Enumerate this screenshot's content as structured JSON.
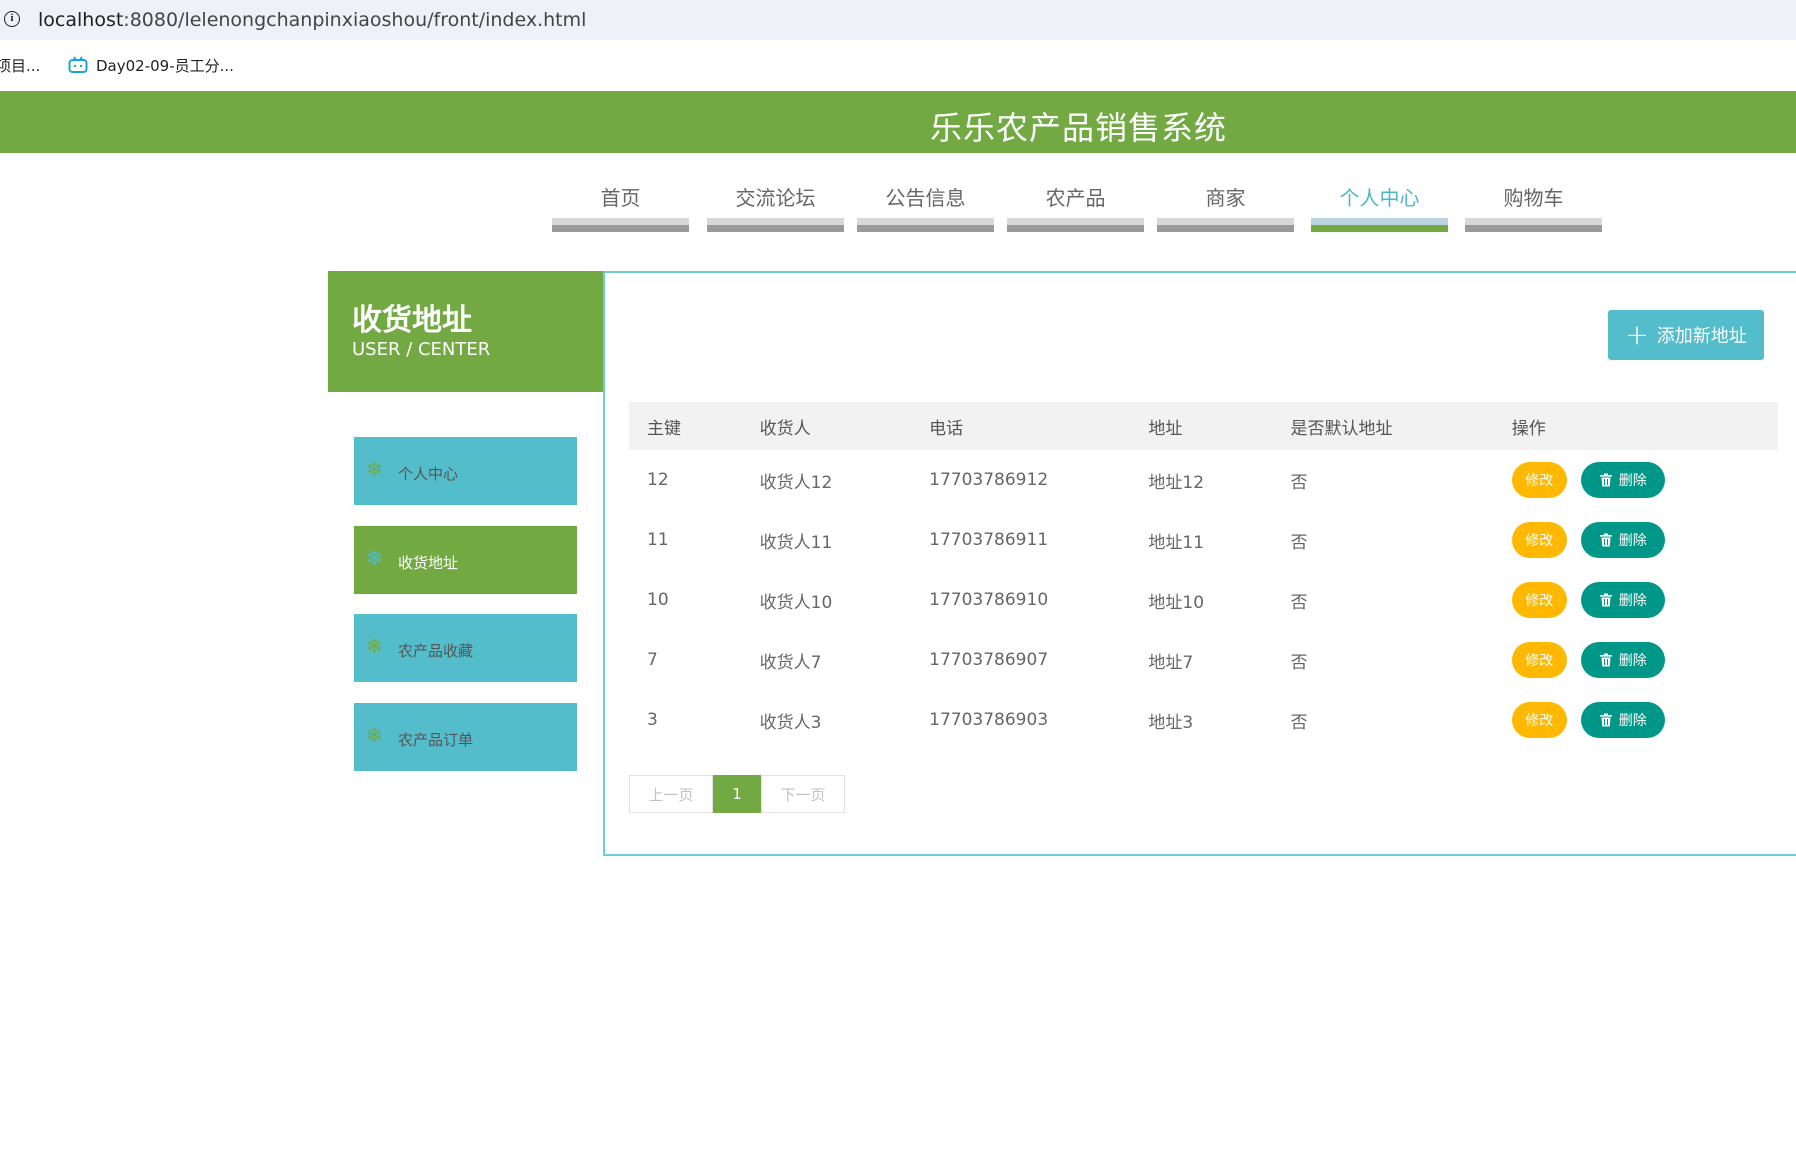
{
  "browser": {
    "url_host": "localhost",
    "url_path": ":8080/lelenongchanpinxiaoshou/front/index.html",
    "bookmarks": [
      {
        "label": "项目..."
      },
      {
        "label": "Day02-09-员工分..."
      }
    ]
  },
  "header": {
    "title": "乐乐农产品销售系统"
  },
  "nav": {
    "items": [
      {
        "label": "首页"
      },
      {
        "label": "交流论坛"
      },
      {
        "label": "公告信息"
      },
      {
        "label": "农产品"
      },
      {
        "label": "商家"
      },
      {
        "label": "个人中心",
        "active": true
      },
      {
        "label": "购物车"
      }
    ]
  },
  "sidebar": {
    "title": "收货地址",
    "subtitle": "USER / CENTER",
    "items": [
      {
        "label": "个人中心"
      },
      {
        "label": "收货地址",
        "active": true
      },
      {
        "label": "农产品收藏"
      },
      {
        "label": "农产品订单"
      }
    ]
  },
  "main": {
    "add_button": "添加新地址",
    "table": {
      "headers": [
        "主键",
        "收货人",
        "电话",
        "地址",
        "是否默认地址",
        "操作"
      ],
      "rows": [
        {
          "id": "12",
          "name": "收货人12",
          "phone": "17703786912",
          "address": "地址12",
          "default": "否"
        },
        {
          "id": "11",
          "name": "收货人11",
          "phone": "17703786911",
          "address": "地址11",
          "default": "否"
        },
        {
          "id": "10",
          "name": "收货人10",
          "phone": "17703786910",
          "address": "地址10",
          "default": "否"
        },
        {
          "id": "7",
          "name": "收货人7",
          "phone": "17703786907",
          "address": "地址7",
          "default": "否"
        },
        {
          "id": "3",
          "name": "收货人3",
          "phone": "17703786903",
          "address": "地址3",
          "default": "否"
        }
      ],
      "edit_label": "修改",
      "delete_label": "删除"
    },
    "pagination": {
      "prev": "上一页",
      "current": "1",
      "next": "下一页"
    }
  },
  "colors": {
    "brand_green": "#72a942",
    "accent_cyan": "#54bdcb",
    "edit_yellow": "#ffb800",
    "delete_teal": "#009688"
  }
}
